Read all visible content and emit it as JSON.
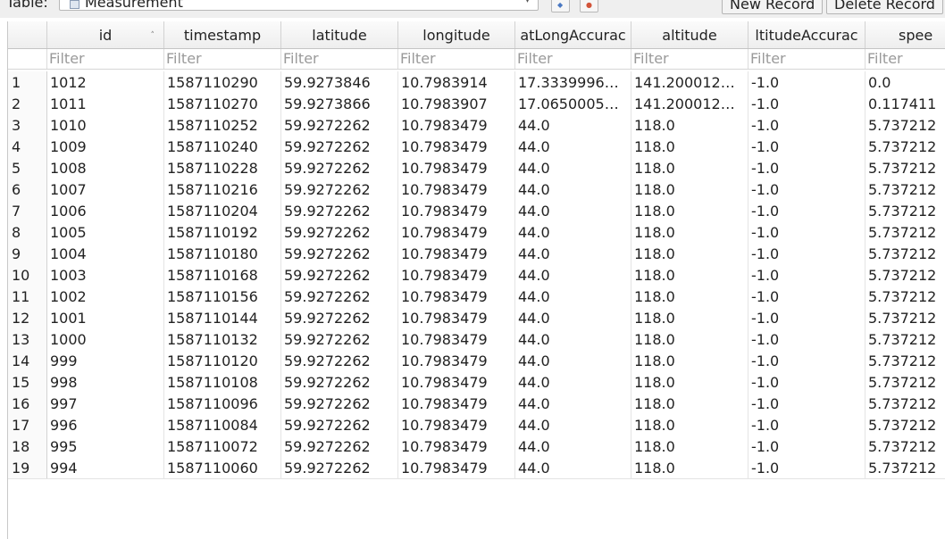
{
  "toolbar": {
    "table_label": "Table:",
    "table_name": "Measurement",
    "new_record": "New Record",
    "delete_record": "Delete Record"
  },
  "columns": [
    "id",
    "timestamp",
    "latitude",
    "longitude",
    "atLongAccurac",
    "altitude",
    "ltitudeAccurac",
    "spee"
  ],
  "filter_placeholder": "Filter",
  "rows": [
    [
      "1",
      "1012",
      "1587110290",
      "59.9273846",
      "10.7983914",
      "17.3339996…",
      "141.200012…",
      "-1.0",
      "0.0"
    ],
    [
      "2",
      "1011",
      "1587110270",
      "59.9273866",
      "10.7983907",
      "17.0650005…",
      "141.200012…",
      "-1.0",
      "0.117411"
    ],
    [
      "3",
      "1010",
      "1587110252",
      "59.9272262",
      "10.7983479",
      "44.0",
      "118.0",
      "-1.0",
      "5.737212"
    ],
    [
      "4",
      "1009",
      "1587110240",
      "59.9272262",
      "10.7983479",
      "44.0",
      "118.0",
      "-1.0",
      "5.737212"
    ],
    [
      "5",
      "1008",
      "1587110228",
      "59.9272262",
      "10.7983479",
      "44.0",
      "118.0",
      "-1.0",
      "5.737212"
    ],
    [
      "6",
      "1007",
      "1587110216",
      "59.9272262",
      "10.7983479",
      "44.0",
      "118.0",
      "-1.0",
      "5.737212"
    ],
    [
      "7",
      "1006",
      "1587110204",
      "59.9272262",
      "10.7983479",
      "44.0",
      "118.0",
      "-1.0",
      "5.737212"
    ],
    [
      "8",
      "1005",
      "1587110192",
      "59.9272262",
      "10.7983479",
      "44.0",
      "118.0",
      "-1.0",
      "5.737212"
    ],
    [
      "9",
      "1004",
      "1587110180",
      "59.9272262",
      "10.7983479",
      "44.0",
      "118.0",
      "-1.0",
      "5.737212"
    ],
    [
      "10",
      "1003",
      "1587110168",
      "59.9272262",
      "10.7983479",
      "44.0",
      "118.0",
      "-1.0",
      "5.737212"
    ],
    [
      "11",
      "1002",
      "1587110156",
      "59.9272262",
      "10.7983479",
      "44.0",
      "118.0",
      "-1.0",
      "5.737212"
    ],
    [
      "12",
      "1001",
      "1587110144",
      "59.9272262",
      "10.7983479",
      "44.0",
      "118.0",
      "-1.0",
      "5.737212"
    ],
    [
      "13",
      "1000",
      "1587110132",
      "59.9272262",
      "10.7983479",
      "44.0",
      "118.0",
      "-1.0",
      "5.737212"
    ],
    [
      "14",
      "999",
      "1587110120",
      "59.9272262",
      "10.7983479",
      "44.0",
      "118.0",
      "-1.0",
      "5.737212"
    ],
    [
      "15",
      "998",
      "1587110108",
      "59.9272262",
      "10.7983479",
      "44.0",
      "118.0",
      "-1.0",
      "5.737212"
    ],
    [
      "16",
      "997",
      "1587110096",
      "59.9272262",
      "10.7983479",
      "44.0",
      "118.0",
      "-1.0",
      "5.737212"
    ],
    [
      "17",
      "996",
      "1587110084",
      "59.9272262",
      "10.7983479",
      "44.0",
      "118.0",
      "-1.0",
      "5.737212"
    ],
    [
      "18",
      "995",
      "1587110072",
      "59.9272262",
      "10.7983479",
      "44.0",
      "118.0",
      "-1.0",
      "5.737212"
    ],
    [
      "19",
      "994",
      "1587110060",
      "59.9272262",
      "10.7983479",
      "44.0",
      "118.0",
      "-1.0",
      "5.737212"
    ]
  ],
  "icons": {
    "table_icon": "table-icon",
    "dropdown": "chevron-down-icon",
    "sort": "sort-ascending-icon",
    "refresh": "refresh-icon",
    "clear_filters": "clear-filters-icon"
  }
}
